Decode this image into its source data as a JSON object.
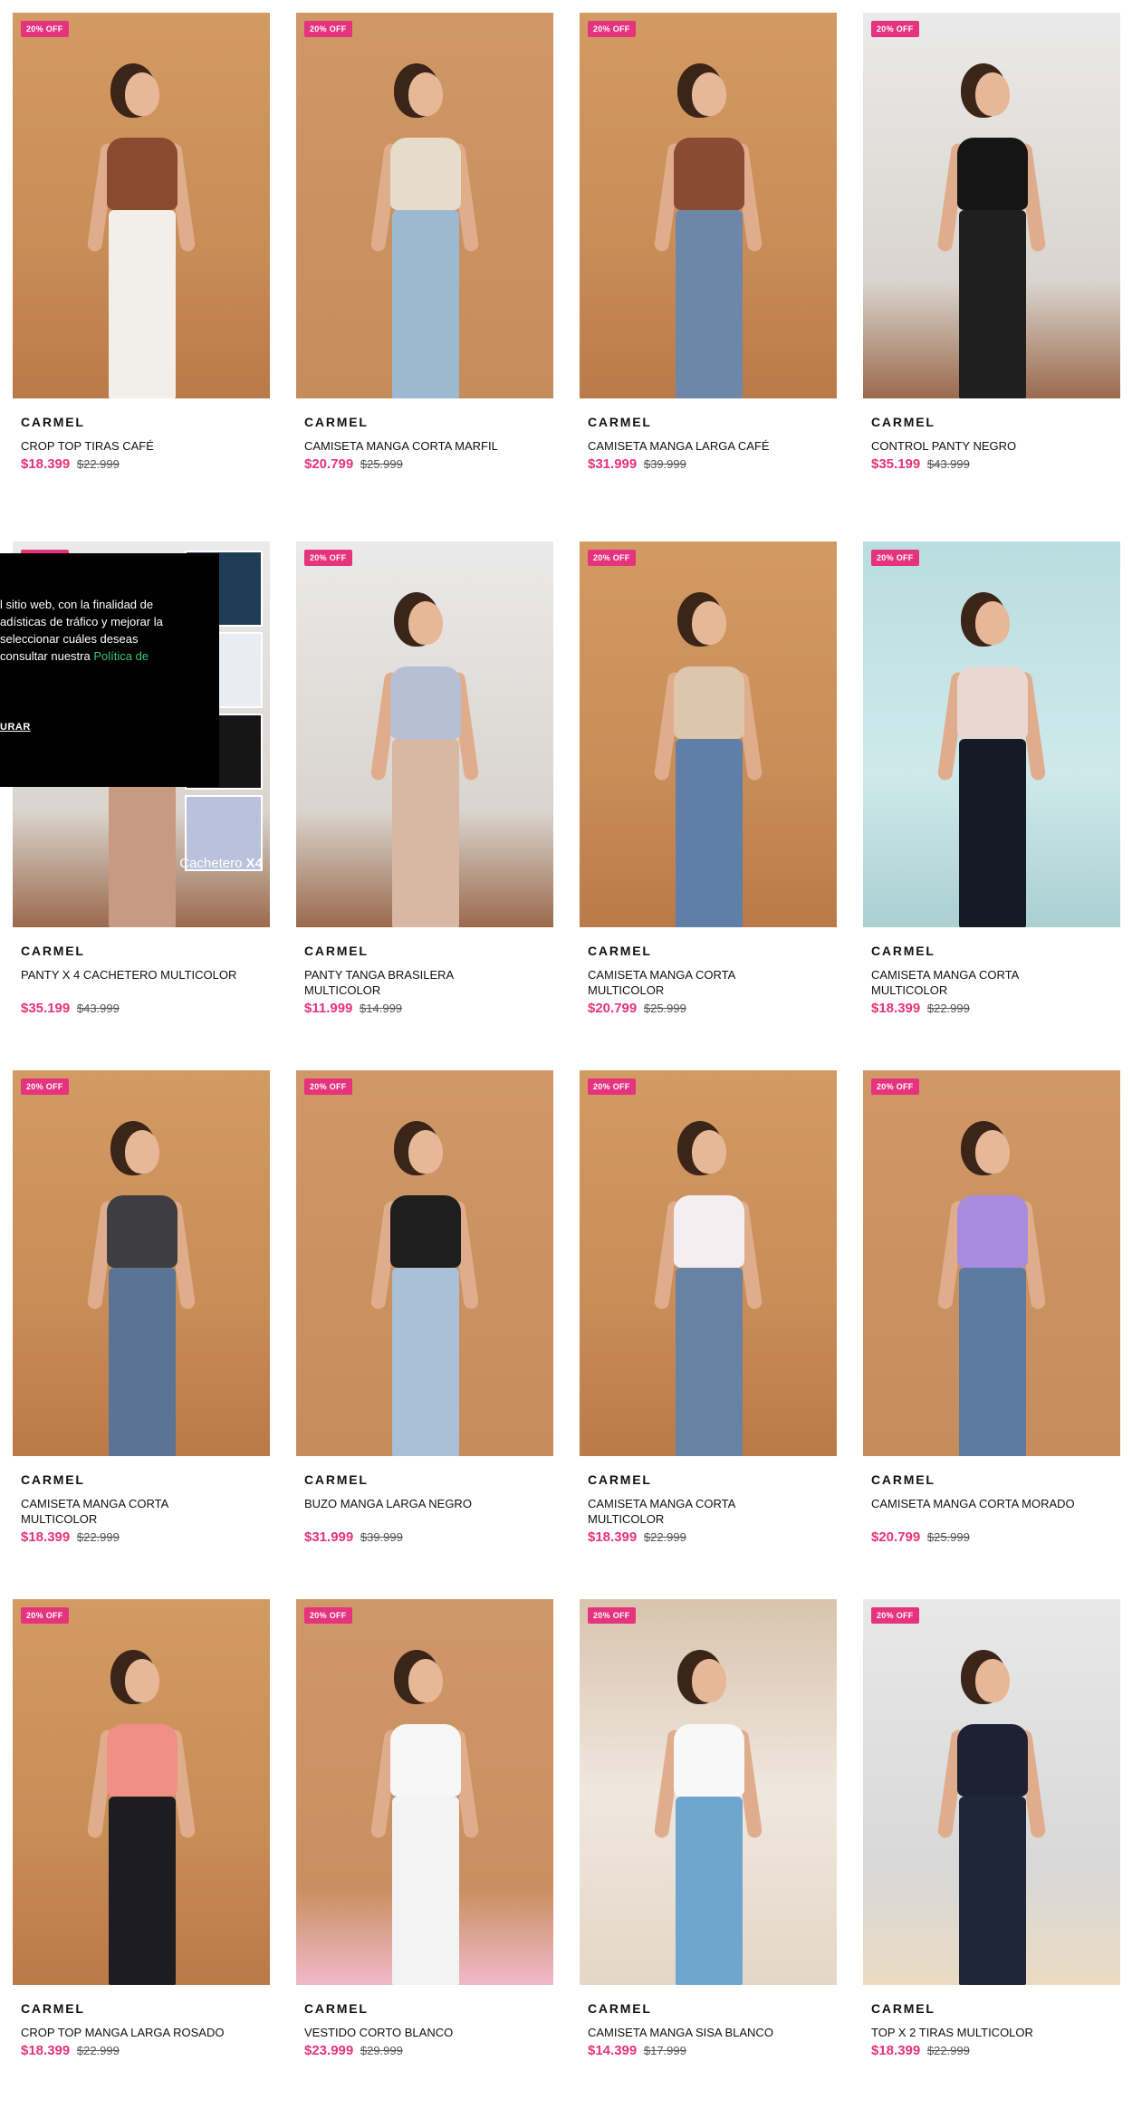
{
  "colors": {
    "accent": "#e5337d",
    "cookie_link": "#3fc77a"
  },
  "products": [
    {
      "badge": "20% OFF",
      "brand": "CARMEL",
      "name": "CROP TOP TIRAS CAFÉ",
      "price": "$18.399",
      "old_price": "$22.999",
      "top": "#8a4a2f",
      "bottom": "#f2efe9",
      "bg": "warm"
    },
    {
      "badge": "20% OFF",
      "brand": "CARMEL",
      "name": "CAMISETA MANGA CORTA MARFIL",
      "price": "$20.799",
      "old_price": "$25.999",
      "top": "#e6dccb",
      "bottom": "#9bbad2",
      "bg": "warm2"
    },
    {
      "badge": "20% OFF",
      "brand": "CARMEL",
      "name": "CAMISETA MANGA LARGA CAFÉ",
      "price": "$31.999",
      "old_price": "$39.999",
      "top": "#8a4b35",
      "bottom": "#6d87a8",
      "bg": "warm"
    },
    {
      "badge": "20% OFF",
      "brand": "CARMEL",
      "name": "CONTROL PANTY NEGRO",
      "price": "$35.199",
      "old_price": "$43.999",
      "top": "#151515",
      "bottom": "#1f1f1f",
      "bg": "room"
    },
    {
      "badge": "20% OFF",
      "brand": "CARMEL",
      "name": "PANTY X 4 CACHETERO MULTICOLOR",
      "price": "$35.199",
      "old_price": "$43.999",
      "top": "#d8b39a",
      "bottom": "#c99a82",
      "bg": "room",
      "collage": true,
      "collage_label": "Cachetero",
      "collage_count": "X4"
    },
    {
      "badge": "20% OFF",
      "brand": "CARMEL",
      "name": "PANTY TANGA BRASILERA MULTICOLOR",
      "price": "$11.999",
      "old_price": "$14.999",
      "top": "#b6c0d4",
      "bottom": "#d8b8a2",
      "bg": "room"
    },
    {
      "badge": "20% OFF",
      "brand": "CARMEL",
      "name": "CAMISETA MANGA CORTA MULTICOLOR",
      "price": "$20.799",
      "old_price": "$25.999",
      "top": "#dcc7ad",
      "bottom": "#5f7ea8",
      "bg": "warm"
    },
    {
      "badge": "20% OFF",
      "brand": "CARMEL",
      "name": "CAMISETA MANGA CORTA MULTICOLOR",
      "price": "$18.399",
      "old_price": "$22.999",
      "top": "#e9d8d2",
      "bottom": "#151b24",
      "bg": "mint"
    },
    {
      "badge": "20% OFF",
      "brand": "CARMEL",
      "name": "CAMISETA MANGA CORTA MULTICOLOR",
      "price": "$18.399",
      "old_price": "$22.999",
      "top": "#3d3d42",
      "bottom": "#5c7396",
      "bg": "warm"
    },
    {
      "badge": "20% OFF",
      "brand": "CARMEL",
      "name": "BUZO MANGA LARGA NEGRO",
      "price": "$31.999",
      "old_price": "$39.999",
      "top": "#1e1e1e",
      "bottom": "#a9c0d6",
      "bg": "warm2"
    },
    {
      "badge": "20% OFF",
      "brand": "CARMEL",
      "name": "CAMISETA MANGA CORTA MULTICOLOR",
      "price": "$18.399",
      "old_price": "$22.999",
      "top": "#f4eef0",
      "bottom": "#6882a4",
      "bg": "warm"
    },
    {
      "badge": "20% OFF",
      "brand": "CARMEL",
      "name": "CAMISETA MANGA CORTA MORADO",
      "price": "$20.799",
      "old_price": "$25.999",
      "top": "#a98be0",
      "bottom": "#5d7aa0",
      "bg": "warm2"
    },
    {
      "badge": "20% OFF",
      "brand": "CARMEL",
      "name": "CROP TOP MANGA LARGA ROSADO",
      "price": "$18.399",
      "old_price": "$22.999",
      "top": "#ef8f86",
      "bottom": "#1c1c22",
      "bg": "warm"
    },
    {
      "badge": "20% OFF",
      "brand": "CARMEL",
      "name": "VESTIDO CORTO BLANCO",
      "price": "$23.999",
      "old_price": "$29.999",
      "top": "#f6f6f6",
      "bottom": "#f3f3f3",
      "bg": "pinkfloor"
    },
    {
      "badge": "20% OFF",
      "brand": "CARMEL",
      "name": "CAMISETA MANGA SISA BLANCO",
      "price": "$14.399",
      "old_price": "$17.999",
      "top": "#f8f8f8",
      "bottom": "#6fa6cf",
      "bg": "arch"
    },
    {
      "badge": "20% OFF",
      "brand": "CARMEL",
      "name": "TOP X 2 TIRAS MULTICOLOR",
      "price": "$18.399",
      "old_price": "$22.999",
      "top": "#1c2233",
      "bottom": "#1f263a",
      "bg": "studio"
    }
  ],
  "cookie": {
    "text": "l sitio web, con la finalidad de\nadísticas de tráfico y mejorar la\nseleccionar cuáles deseas\n consultar nuestra ",
    "link": "Política de",
    "configure": "URAR"
  }
}
